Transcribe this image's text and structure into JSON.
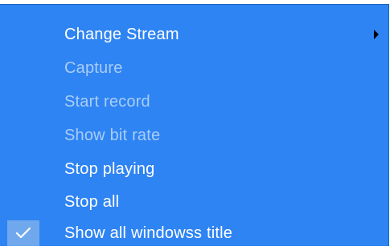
{
  "menu": {
    "items": [
      {
        "label": "Change Stream",
        "enabled": true,
        "submenu": true
      },
      {
        "label": "Capture",
        "enabled": false
      },
      {
        "label": "Start record",
        "enabled": false
      },
      {
        "label": "Show bit rate",
        "enabled": false
      },
      {
        "label": "Stop playing",
        "enabled": true
      },
      {
        "label": "Stop all",
        "enabled": true
      },
      {
        "label": "Show all windowss title",
        "enabled": true,
        "checked": true
      }
    ],
    "colors": {
      "background": "#2f84f3",
      "enabled_text": "#ffffff",
      "disabled_text": "#a9cdf8",
      "check_background": "#6fa8ec"
    },
    "icons": {
      "submenu": "submenu-arrow-icon",
      "check": "checkmark-icon"
    }
  }
}
